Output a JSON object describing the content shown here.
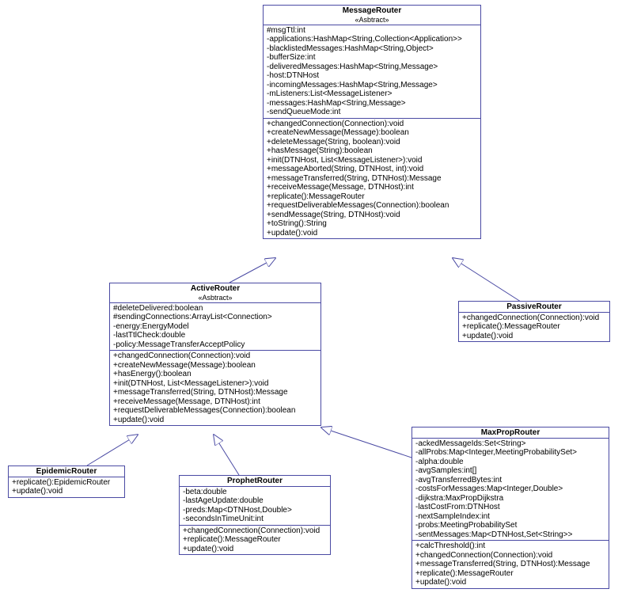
{
  "classes": {
    "messageRouter": {
      "name": "MessageRouter",
      "stereo": "«Asbtract»",
      "attrs": [
        "#msgTtl:int",
        "-applications:HashMap<String,Collection<Application>>",
        "-blacklistedMessages:HashMap<String,Object>",
        "-bufferSize:int",
        "-deliveredMessages:HashMap<String,Message>",
        "-host:DTNHost",
        "-incomingMessages:HashMap<String,Message>",
        "-mListeners:List<MessageListener>",
        "-messages:HashMap<String,Message>",
        "-sendQueueMode:int"
      ],
      "ops": [
        "+changedConnection(Connection):void",
        "+createNewMessage(Message):boolean",
        "+deleteMessage(String, boolean):void",
        "+hasMessage(String):boolean",
        "+init(DTNHost, List<MessageListener>):void",
        "+messageAborted(String, DTNHost, int):void",
        "+messageTransferred(String, DTNHost):Message",
        "+receiveMessage(Message, DTNHost):int",
        "+replicate():MessageRouter",
        "+requestDeliverableMessages(Connection):boolean",
        "+sendMessage(String, DTNHost):void",
        "+toString():String",
        "+update():void"
      ]
    },
    "activeRouter": {
      "name": "ActiveRouter",
      "stereo": "«Asbtract»",
      "attrs": [
        "#deleteDelivered:boolean",
        "#sendingConnections:ArrayList<Connection>",
        "-energy:EnergyModel",
        "-lastTtlCheck:double",
        "-policy:MessageTransferAcceptPolicy"
      ],
      "ops": [
        "+changedConnection(Connection):void",
        "+createNewMessage(Message):boolean",
        "+hasEnergy():boolean",
        "+init(DTNHost, List<MessageListener>):void",
        "+messageTransferred(String, DTNHost):Message",
        "+receiveMessage(Message, DTNHost):int",
        "+requestDeliverableMessages(Connection):boolean",
        "+update():void"
      ]
    },
    "passiveRouter": {
      "name": "PassiveRouter",
      "ops": [
        "+changedConnection(Connection):void",
        "+replicate():MessageRouter",
        "+update():void"
      ]
    },
    "epidemicRouter": {
      "name": "EpidemicRouter",
      "ops": [
        "+replicate():EpidemicRouter",
        "+update():void"
      ]
    },
    "prophetRouter": {
      "name": "ProphetRouter",
      "attrs": [
        "-beta:double",
        "-lastAgeUpdate:double",
        "-preds:Map<DTNHost,Double>",
        "-secondsInTimeUnit:int"
      ],
      "ops": [
        "+changedConnection(Connection):void",
        "+replicate():MessageRouter",
        "+update():void"
      ]
    },
    "maxPropRouter": {
      "name": "MaxPropRouter",
      "attrs": [
        "-ackedMessageIds:Set<String>",
        "-allProbs:Map<Integer,MeetingProbabilitySet>",
        "-alpha:double",
        "-avgSamples:int[]",
        "-avgTransferredBytes:int",
        "-costsForMessages:Map<Integer,Double>",
        "-dijkstra:MaxPropDijkstra",
        "-lastCostFrom:DTNHost",
        "-nextSampleIndex:int",
        "-probs:MeetingProbabilitySet",
        "-sentMessages:Map<DTNHost,Set<String>>"
      ],
      "ops": [
        "+calcThreshold():int",
        "+changedConnection(Connection):void",
        "+messageTransferred(String, DTNHost):Message",
        "+replicate():MessageRouter",
        "+update():void"
      ]
    }
  }
}
